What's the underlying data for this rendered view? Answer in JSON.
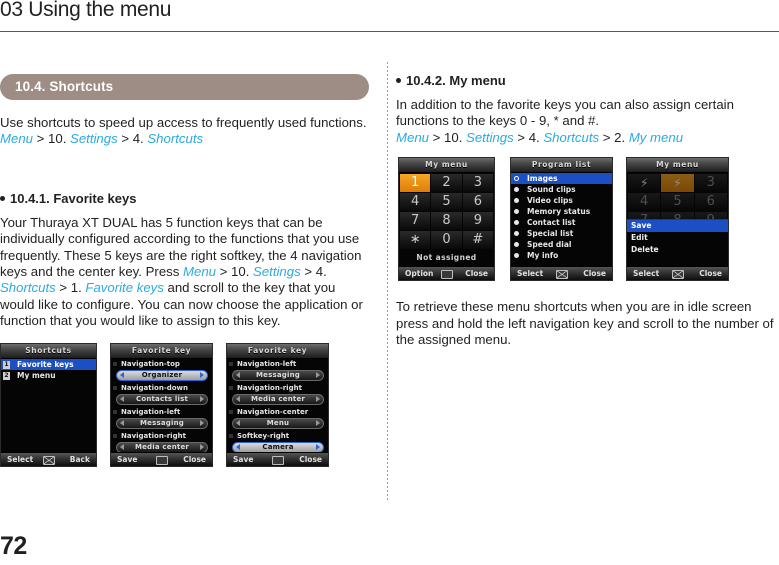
{
  "header": {
    "chapter_title": "03 Using the menu"
  },
  "page_number": "72",
  "left": {
    "section": {
      "label": "10.4. Shortcuts"
    },
    "intro": {
      "line1": "Use shortcuts to speed up access to frequently used functions.",
      "path_menu": "Menu",
      "path_sep1": " > 10. ",
      "path_settings": "Settings",
      "path_sep2": " > 4. ",
      "path_shortcuts": "Shortcuts"
    },
    "subhead": "10.4.1. Favorite keys",
    "para": {
      "t1": "Your Thuraya XT DUAL has 5 function keys that can be individually configured according to the functions that you use frequently. These 5 keys are the right softkey, the 4 navigation keys and the center key. Press ",
      "menu": "Menu",
      "t2": " > 10. ",
      "settings": "Settings",
      "t3": " > 4. ",
      "shortcuts": "Shortcuts",
      "t4": " > 1. ",
      "favorite_keys": "Favorite keys",
      "t5": " and scroll to the key that you would like to configure. You can now choose the application or function that you would like to assign to this key."
    },
    "shots": {
      "shot1": {
        "title": "Shortcuts",
        "rows": [
          {
            "num": "1",
            "label": "Favorite keys",
            "selected": true
          },
          {
            "num": "2",
            "label": "My menu",
            "selected": false
          }
        ],
        "softkeys": {
          "left": "Select",
          "center": "envelope-icon",
          "right": "Back"
        }
      },
      "shot2": {
        "title": "Favorite key",
        "fields": [
          {
            "label": "Navigation-top",
            "value": "Organizer",
            "selected": true
          },
          {
            "label": "Navigation-down",
            "value": "Contacts list",
            "selected": false
          },
          {
            "label": "Navigation-left",
            "value": "Messaging",
            "selected": false
          },
          {
            "label": "Navigation-right",
            "value": "Media center",
            "selected": false
          }
        ],
        "softkeys": {
          "left": "Save",
          "center": "screen-icon",
          "right": "Close"
        }
      },
      "shot3": {
        "title": "Favorite key",
        "fields": [
          {
            "label": "Navigation-left",
            "value": "Messaging",
            "selected": false
          },
          {
            "label": "Navigation-right",
            "value": "Media center",
            "selected": false
          },
          {
            "label": "Navigation-center",
            "value": "Menu",
            "selected": false
          },
          {
            "label": "Softkey-right",
            "value": "Camera",
            "selected": true
          }
        ],
        "softkeys": {
          "left": "Save",
          "center": "screen-icon",
          "right": "Close"
        }
      }
    }
  },
  "right": {
    "subhead": "10.4.2. My menu",
    "para1": {
      "t1": "In addition to the favorite keys you can also assign certain functions to the keys 0 - 9, * and #.",
      "menu": "Menu",
      "t2": " > 10. ",
      "settings": "Settings",
      "t3": " > 4. ",
      "shortcuts": "Shortcuts",
      "t4": " > 2. ",
      "my_menu": "My menu"
    },
    "para2": "To retrieve these menu shortcuts when you are in idle screen press and hold the left navigation key and scroll to the number of the assigned menu.",
    "shots": {
      "shot1": {
        "title": "My menu",
        "keys": [
          {
            "label": "1",
            "highlight": true
          },
          {
            "label": "2",
            "highlight": false
          },
          {
            "label": "3",
            "highlight": false
          },
          {
            "label": "4",
            "highlight": false
          },
          {
            "label": "5",
            "highlight": false
          },
          {
            "label": "6",
            "highlight": false
          },
          {
            "label": "7",
            "highlight": false
          },
          {
            "label": "8",
            "highlight": false
          },
          {
            "label": "9",
            "highlight": false
          },
          {
            "label": "∗",
            "highlight": false
          },
          {
            "label": "0",
            "highlight": false
          },
          {
            "label": "#",
            "highlight": false
          }
        ],
        "status": "Not assigned",
        "softkeys": {
          "left": "Option",
          "center": "screen-icon",
          "right": "Close"
        }
      },
      "shot2": {
        "title": "Program list",
        "rows": [
          {
            "label": "Images",
            "selected": true
          },
          {
            "label": "Sound clips",
            "selected": false
          },
          {
            "label": "Video clips",
            "selected": false
          },
          {
            "label": "Memory status",
            "selected": false
          },
          {
            "label": "Contact list",
            "selected": false
          },
          {
            "label": "Special list",
            "selected": false
          },
          {
            "label": "Speed dial",
            "selected": false
          },
          {
            "label": "My info",
            "selected": false
          }
        ],
        "softkeys": {
          "left": "Select",
          "center": "envelope-icon",
          "right": "Close"
        }
      },
      "shot3": {
        "title": "My menu",
        "keys": [
          {
            "label": "⚡",
            "highlight": false,
            "bolt": true
          },
          {
            "label": "⚡",
            "highlight": true,
            "bolt": true
          },
          {
            "label": "3",
            "highlight": false
          },
          {
            "label": "4",
            "highlight": false
          },
          {
            "label": "5",
            "highlight": false
          },
          {
            "label": "6",
            "highlight": false
          },
          {
            "label": "7",
            "highlight": false
          },
          {
            "label": "8",
            "highlight": false
          },
          {
            "label": "9",
            "highlight": false
          }
        ],
        "popup": [
          {
            "label": "Save",
            "selected": true
          },
          {
            "label": "Edit",
            "selected": false
          },
          {
            "label": "Delete",
            "selected": false
          }
        ],
        "softkeys": {
          "left": "Select",
          "center": "envelope-icon",
          "right": "Close"
        }
      }
    }
  },
  "colors": {
    "section_bar": "#9d8d85",
    "path_link": "#29abe2",
    "selection_blue": "#1d4fc4",
    "highlight_orange": "#f5a623",
    "text": "#231f20"
  }
}
